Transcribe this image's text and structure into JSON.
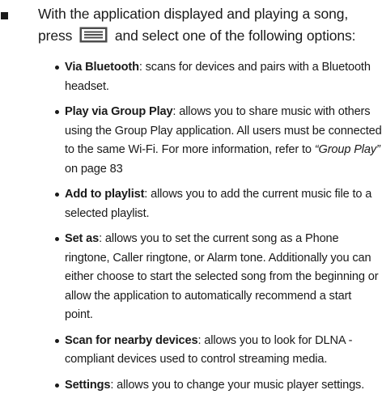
{
  "intro": {
    "before": "With the application displayed and playing a song, press",
    "after": "and select one of the following options:",
    "key_icon": "menu-key-icon"
  },
  "options": [
    {
      "term": "Via Bluetooth",
      "desc": ": scans for devices and pairs with a Bluetooth headset."
    },
    {
      "term": "Play via Group Play",
      "desc": ": allows you to share music with others using the Group Play application. All users must be connected to the same Wi-Fi. For more information, refer to ",
      "ref": "“Group Play”",
      "ref_tail": " on page 83"
    },
    {
      "term": "Add to playlist",
      "desc": ": allows you to add the current music file to a selected playlist."
    },
    {
      "term": "Set as",
      "desc": ": allows you to set the current song as a Phone ringtone, Caller ringtone, or Alarm tone. Additionally you can either choose to start the selected song from the beginning or allow the application to automatically recommend a start point."
    },
    {
      "term": "Scan for nearby devices",
      "desc": ": allows you to look for DLNA - compliant devices used to control streaming media."
    },
    {
      "term": "Settings",
      "desc": ": allows you to change your music player settings."
    }
  ]
}
